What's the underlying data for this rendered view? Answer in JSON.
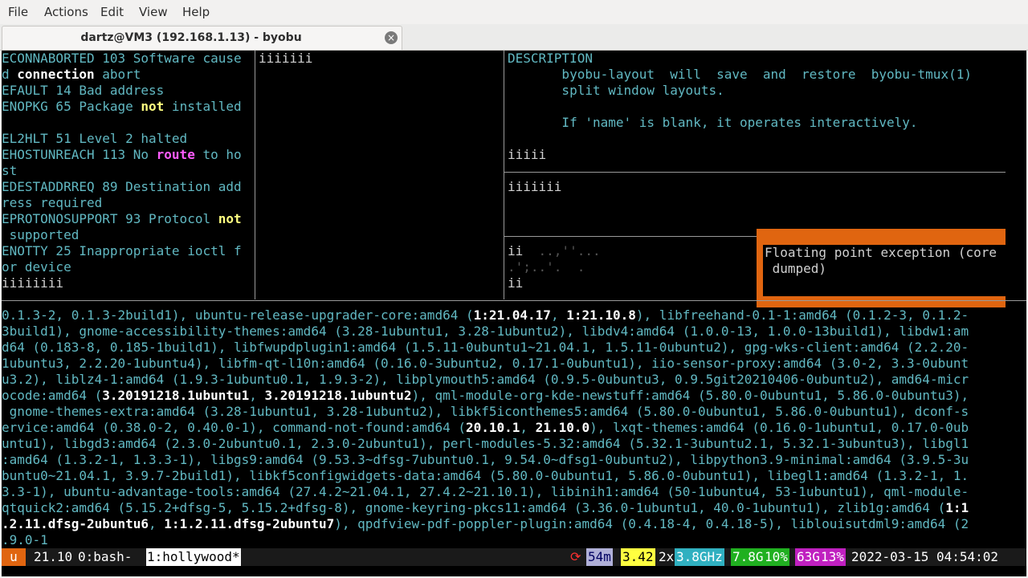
{
  "menu": [
    "File",
    "Actions",
    "Edit",
    "View",
    "Help"
  ],
  "tab": {
    "title": "dartz@VM3 (192.168.1.13) - byobu"
  },
  "pane_left": [
    [
      [
        "t",
        "ECONNABORTED 103 Software cause"
      ]
    ],
    [
      [
        "t",
        "d "
      ],
      [
        "w",
        "connection"
      ],
      [
        "t",
        " abort"
      ]
    ],
    [
      [
        "t",
        "EFAULT 14 Bad address"
      ]
    ],
    [
      [
        "t",
        "ENOPKG 65 Package "
      ],
      [
        "y",
        "not"
      ],
      [
        "t",
        " installed"
      ]
    ],
    [],
    [
      [
        "t",
        "EL2HLT 51 Level 2 halted"
      ]
    ],
    [
      [
        "t",
        "EHOSTUNREACH 113 No "
      ],
      [
        "m",
        "route"
      ],
      [
        "t",
        " to ho"
      ]
    ],
    [
      [
        "t",
        "st"
      ]
    ],
    [
      [
        "t",
        "EDESTADDRREQ 89 Destination add"
      ]
    ],
    [
      [
        "t",
        "ress required"
      ]
    ],
    [
      [
        "t",
        "EPROTONOSUPPORT 93 Protocol "
      ],
      [
        "y",
        "not"
      ]
    ],
    [
      [
        "t",
        " supported"
      ]
    ],
    [
      [
        "t",
        "ENOTTY 25 Inappropriate ioctl f"
      ]
    ],
    [
      [
        "t",
        "or device"
      ]
    ],
    [
      [
        "gry",
        "iiiiiiii"
      ]
    ]
  ],
  "pane_mid": "iiiiiii",
  "pane_right_top": [
    [
      [
        "t",
        "DESCRIPTION"
      ]
    ],
    [
      [
        "t",
        "       byobu-layout  will  save  and  restore  byobu-tmux(1)"
      ]
    ],
    [
      [
        "t",
        "       split window layouts."
      ]
    ],
    [],
    [
      [
        "t",
        "       If 'name' is blank, it operates interactively."
      ]
    ],
    [],
    [
      [
        "gry",
        "iiiii"
      ]
    ]
  ],
  "pane_right_mid": "iiiiiii",
  "pane_right_bottom": [
    [
      [
        "gry",
        "ii"
      ],
      [
        "dim",
        "  ..,''..."
      ]
    ],
    [
      [
        "dim",
        ".';..'.  ."
      ]
    ],
    [
      [
        "gry",
        "ii"
      ]
    ]
  ],
  "float": {
    "line1": "Floating point exception (core",
    "line2": " dumped)"
  },
  "bottom": [
    [
      [
        "t",
        "0.1.3-2, 0.1.3-2build1), ubuntu-release-upgrader-core:amd64 ("
      ],
      [
        "w",
        "1:21.04.17"
      ],
      [
        "t",
        ", "
      ],
      [
        "w",
        "1:21.10.8"
      ],
      [
        "t",
        "), libfreehand-0.1-1:amd64 (0.1.2-3, 0.1.2-"
      ]
    ],
    [
      [
        "t",
        "3build1), gnome-accessibility-themes:amd64 (3.28-1ubuntu1, 3.28-1ubuntu2), libdv4:amd64 (1.0.0-13, 1.0.0-13build1), libdw1:am"
      ]
    ],
    [
      [
        "t",
        "d64 (0.183-8, 0.185-1build1), libfwupdplugin1:amd64 (1.5.11-0ubuntu1~21.04.1, 1.5.11-0ubuntu2), gpg-wks-client:amd64 (2.2.20-"
      ]
    ],
    [
      [
        "t",
        "1ubuntu3, 2.2.20-1ubuntu4), libfm-qt-l10n:amd64 (0.16.0-3ubuntu2, 0.17.1-0ubuntu1), iio-sensor-proxy:amd64 (3.0-2, 3.3-0ubunt"
      ]
    ],
    [
      [
        "t",
        "u3.2), liblz4-1:amd64 (1.9.3-1ubuntu0.1, 1.9.3-2), libplymouth5:amd64 (0.9.5-0ubuntu3, 0.9.5git20210406-0ubuntu2), amd64-micr"
      ]
    ],
    [
      [
        "t",
        "ocode:amd64 ("
      ],
      [
        "w",
        "3.20191218.1ubuntu1"
      ],
      [
        "t",
        ", "
      ],
      [
        "w",
        "3.20191218.1ubuntu2"
      ],
      [
        "t",
        "), qml-module-org-kde-newstuff:amd64 (5.80.0-0ubuntu1, 5.86.0-0ubuntu3),"
      ]
    ],
    [
      [
        "t",
        " gnome-themes-extra:amd64 (3.28-1ubuntu1, 3.28-1ubuntu2), libkf5iconthemes5:amd64 (5.80.0-0ubuntu1, 5.86.0-0ubuntu1), dconf-s"
      ]
    ],
    [
      [
        "t",
        "ervice:amd64 (0.38.0-2, 0.40.0-1), command-not-found:amd64 ("
      ],
      [
        "w",
        "20.10.1"
      ],
      [
        "t",
        ", "
      ],
      [
        "w",
        "21.10.0"
      ],
      [
        "t",
        "), lxqt-themes:amd64 (0.16.0-1ubuntu1, 0.17.0-0ub"
      ]
    ],
    [
      [
        "t",
        "untu1), libgd3:amd64 (2.3.0-2ubuntu0.1, 2.3.0-2ubuntu1), perl-modules-5.32:amd64 (5.32.1-3ubuntu2.1, 5.32.1-3ubuntu3), libgl1"
      ]
    ],
    [
      [
        "t",
        ":amd64 (1.3.2-1, 1.3.3-1), libgs9:amd64 (9.53.3~dfsg-7ubuntu0.1, 9.54.0~dfsg1-0ubuntu2), libpython3.9-minimal:amd64 (3.9.5-3u"
      ]
    ],
    [
      [
        "t",
        "buntu0~21.04.1, 3.9.7-2build1), libkf5configwidgets-data:amd64 (5.80.0-0ubuntu1, 5.86.0-0ubuntu1), libegl1:amd64 (1.3.2-1, 1."
      ]
    ],
    [
      [
        "t",
        "3.3-1), ubuntu-advantage-tools:amd64 (27.4.2~21.04.1, 27.4.2~21.10.1), libinih1:amd64 (50-1ubuntu4, 53-1ubuntu1), qml-module-"
      ]
    ],
    [
      [
        "t",
        "qtquick2:amd64 (5.15.2+dfsg-5, 5.15.2+dfsg-8), gnome-keyring-pkcs11:amd64 (3.36.0-1ubuntu1, 40.0-1ubuntu1), zlib1g:amd64 ("
      ],
      [
        "w",
        "1:1"
      ]
    ],
    [
      [
        "w",
        ".2.11.dfsg-2ubuntu6"
      ],
      [
        "t",
        ", "
      ],
      [
        "w",
        "1:1.2.11.dfsg-2ubuntu7"
      ],
      [
        "t",
        "), qpdfview-pdf-poppler-plugin:amd64 (0.4.18-4, 0.4.18-5), liblouisutdml9:amd64 (2"
      ]
    ],
    [
      [
        "t",
        ".9.0-1"
      ]
    ]
  ],
  "statusbar": {
    "logo": "u",
    "release": "21.10",
    "win0": "0:bash-",
    "win1": "1:hollywood*",
    "reboot_icon": "⟳",
    "uptime": "54m",
    "load": "3.42",
    "cpu_count": "2x",
    "cpu_freq": "3.8GHz",
    "mem_total": "7.8G",
    "mem_pct": "10%",
    "disk_total": "63G",
    "disk_pct": "13%",
    "datetime": "2022-03-15 04:54:02"
  }
}
